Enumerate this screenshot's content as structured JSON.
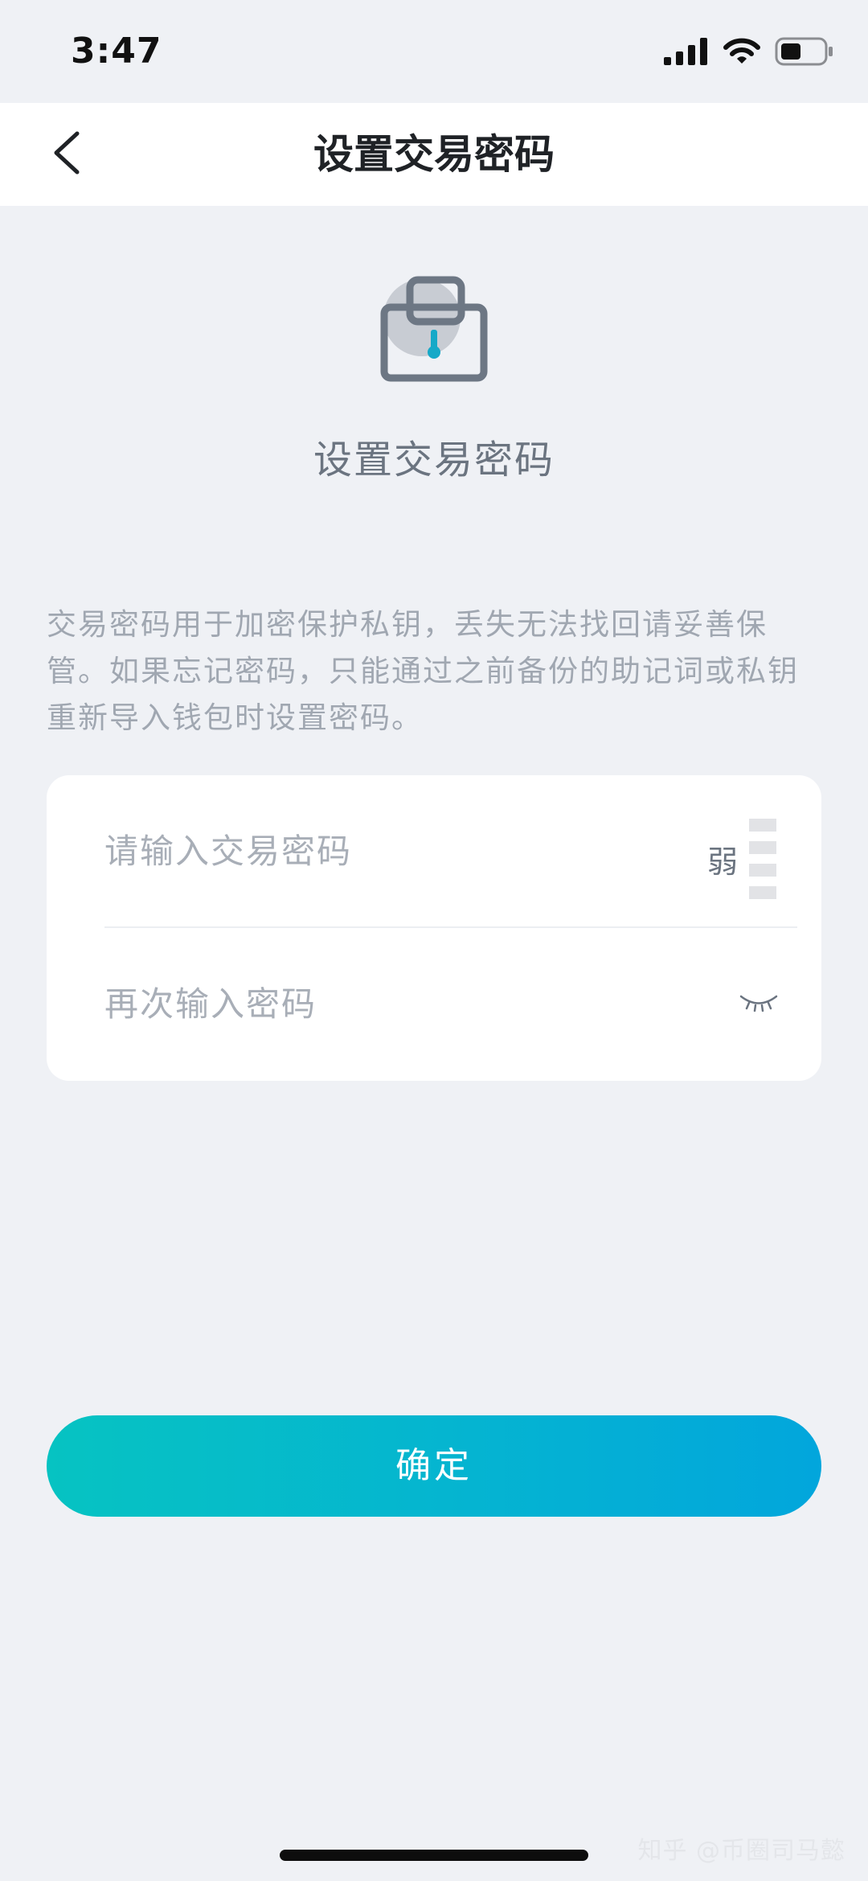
{
  "status_bar": {
    "time": "3:47",
    "icons": [
      "signal-icon",
      "wifi-icon",
      "battery-icon"
    ]
  },
  "nav": {
    "back_icon": "chevron-left-icon",
    "title": "设置交易密码"
  },
  "hero": {
    "icon": "lock-icon",
    "title": "设置交易密码"
  },
  "notice": "交易密码用于加密保护私钥，丢失无法找回请妥善保管。如果忘记密码，只能通过之前备份的助记词或私钥重新导入钱包时设置密码。",
  "form": {
    "password": {
      "value": "",
      "placeholder": "请输入交易密码",
      "strength_label": "弱",
      "strength_bars_total": 4,
      "strength_bars_filled": 0
    },
    "confirm_password": {
      "value": "",
      "placeholder": "再次输入密码",
      "toggle_icon": "eye-closed-icon"
    }
  },
  "confirm_button": {
    "label": "确定"
  },
  "watermark": "知乎 @币圈司马懿",
  "colors": {
    "background": "#eff1f5",
    "accent_start": "#06c3c2",
    "accent_end": "#02a6dc",
    "muted_text": "#a0a7b1"
  }
}
